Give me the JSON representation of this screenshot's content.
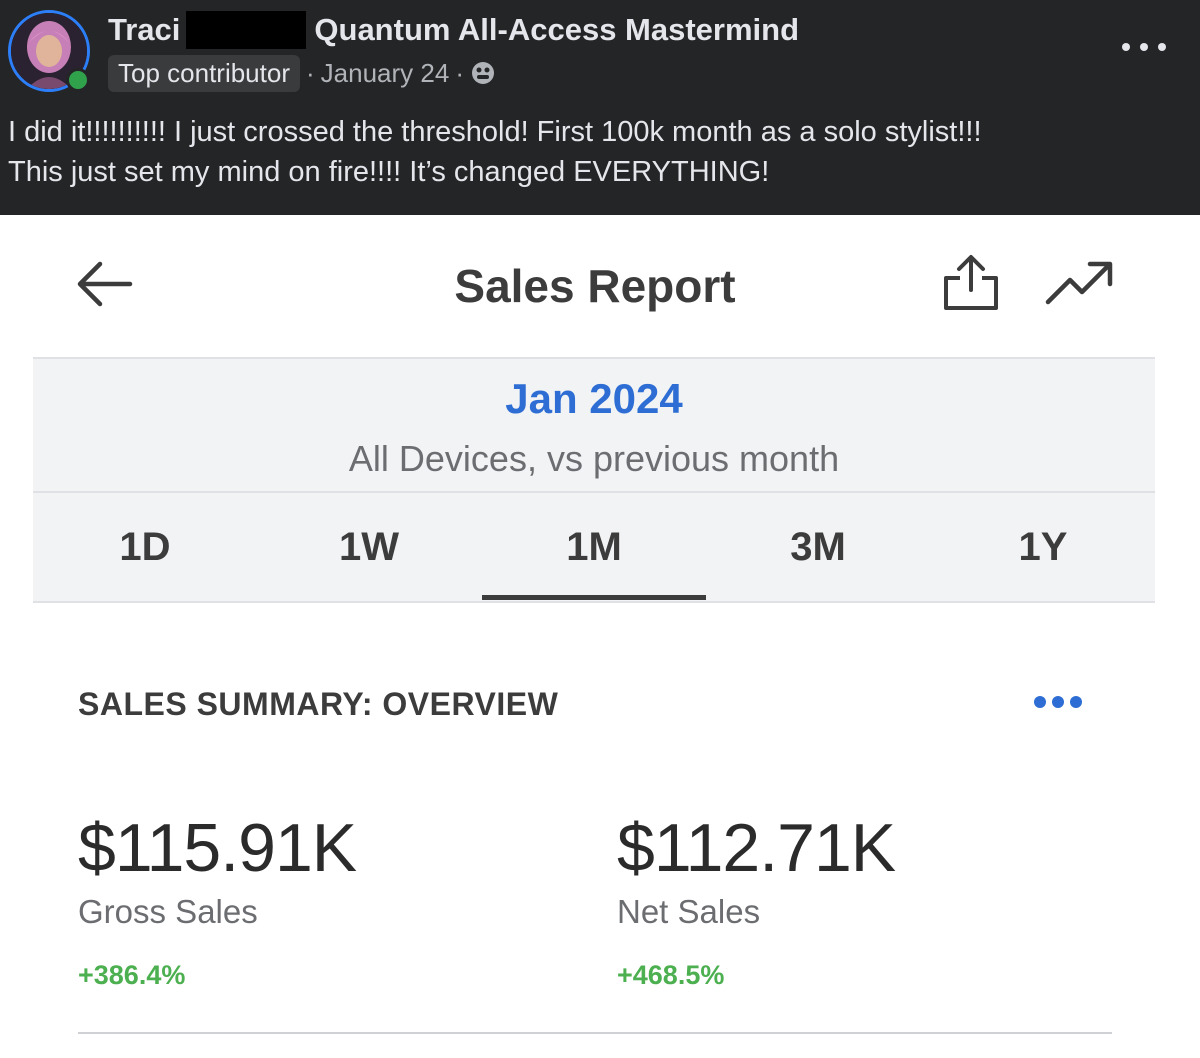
{
  "post": {
    "author_name": "Traci",
    "group_name": "Quantum All-Access Mastermind",
    "badge": "Top contributor",
    "date": "January 24",
    "separator": "·",
    "audience_icon": "globe-icon",
    "more_icon": "more-horizontal-icon",
    "text_lines": [
      "I did it!!!!!!!!!! I just crossed the threshold!   First 100k month as a solo stylist!!!",
      "This just set my mind on fire!!!! It’s changed EVERYTHING!"
    ]
  },
  "report": {
    "title": "Sales Report",
    "back_icon": "arrow-left-icon",
    "share_icon": "share-icon",
    "trend_icon": "trending-up-icon",
    "period": {
      "month": "Jan 2024",
      "subtitle": "All Devices, vs previous month"
    },
    "tabs": [
      {
        "label": "1D",
        "selected": false
      },
      {
        "label": "1W",
        "selected": false
      },
      {
        "label": "1M",
        "selected": true
      },
      {
        "label": "3M",
        "selected": false
      },
      {
        "label": "1Y",
        "selected": false
      }
    ],
    "summary": {
      "title": "SALES SUMMARY: OVERVIEW",
      "more_icon": "more-horizontal-icon",
      "metrics": [
        {
          "value": "$115.91K",
          "label": "Gross Sales",
          "change": "+386.4%"
        },
        {
          "value": "$112.71K",
          "label": "Net Sales",
          "change": "+468.5%"
        }
      ]
    }
  },
  "colors": {
    "post_background": "#242526",
    "accent_blue": "#2e6ed4",
    "positive_green": "#4caf50",
    "online_green": "#31a24c"
  }
}
